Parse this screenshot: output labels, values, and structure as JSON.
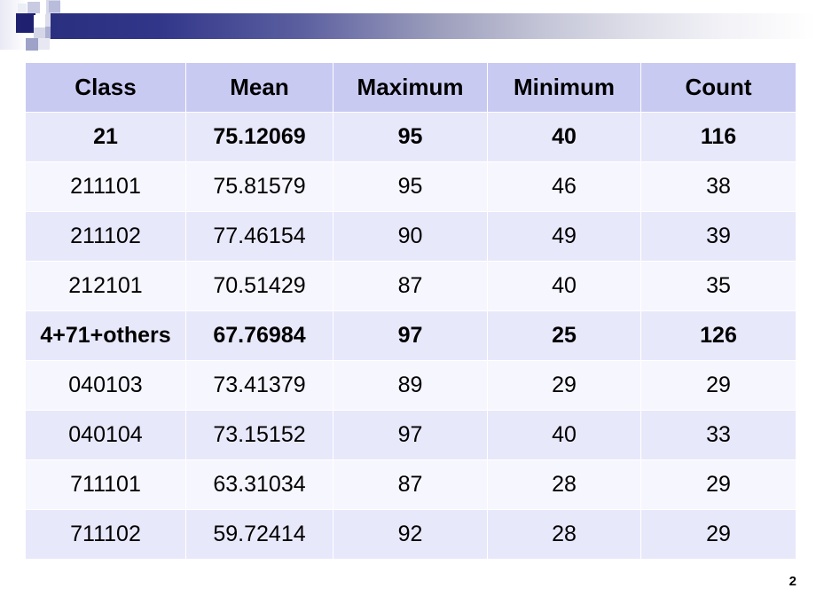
{
  "slide": {
    "page_number": "2",
    "accent_dark": "#1f2170",
    "accent_header_fill": "#c9caf2",
    "row_shade_light": "#f6f6fe",
    "row_shade_dark": "#e8e8fb"
  },
  "table": {
    "columns": [
      "Class",
      "Mean",
      "Maximum",
      "Minimum",
      "Count"
    ],
    "rows": [
      {
        "emphasis": true,
        "shade": "b",
        "small_label": false,
        "cells": [
          "21",
          "75.12069",
          "95",
          "40",
          "116"
        ]
      },
      {
        "emphasis": false,
        "shade": "a",
        "small_label": false,
        "cells": [
          "211101",
          "75.81579",
          "95",
          "46",
          "38"
        ]
      },
      {
        "emphasis": false,
        "shade": "b",
        "small_label": false,
        "cells": [
          "211102",
          "77.46154",
          "90",
          "49",
          "39"
        ]
      },
      {
        "emphasis": false,
        "shade": "a",
        "small_label": false,
        "cells": [
          "212101",
          "70.51429",
          "87",
          "40",
          "35"
        ]
      },
      {
        "emphasis": true,
        "shade": "b",
        "small_label": true,
        "cells": [
          "4+71+others",
          "67.76984",
          "97",
          "25",
          "126"
        ]
      },
      {
        "emphasis": false,
        "shade": "a",
        "small_label": false,
        "cells": [
          "040103",
          "73.41379",
          "89",
          "29",
          "29"
        ]
      },
      {
        "emphasis": false,
        "shade": "b",
        "small_label": false,
        "cells": [
          "040104",
          "73.15152",
          "97",
          "40",
          "33"
        ]
      },
      {
        "emphasis": false,
        "shade": "a",
        "small_label": false,
        "cells": [
          "711101",
          "63.31034",
          "87",
          "28",
          "29"
        ]
      },
      {
        "emphasis": false,
        "shade": "b",
        "small_label": false,
        "cells": [
          "711102",
          "59.72414",
          "92",
          "28",
          "29"
        ]
      }
    ]
  }
}
